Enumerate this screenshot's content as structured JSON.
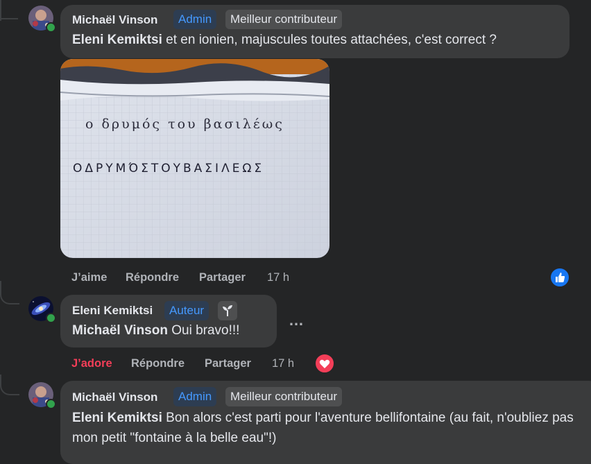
{
  "comments": [
    {
      "author": "Michaël Vinson",
      "badges": [
        "Admin",
        "Meilleur contributeur"
      ],
      "mention": "Eleni Kemiktsi",
      "text": " et en ionien, majuscules toutes attachées, c'est correct ?",
      "image": {
        "line1": "ο δρυμός του βασιλέως",
        "line2": "ΟΔΡΥΜΌΣΤΟΥΒΑΣΙΛΕΩΣ"
      },
      "actions": {
        "like": "J’aime",
        "reply": "Répondre",
        "share": "Partager",
        "time": "17 h"
      },
      "reaction": "like-icon"
    },
    {
      "author": "Eleni Kemiktsi",
      "badges": [
        "Auteur"
      ],
      "mention": "Michaël Vinson",
      "text": " Oui bravo!!!",
      "more": "…",
      "actions": {
        "like": "J’adore",
        "reply": "Répondre",
        "share": "Partager",
        "time": "17 h"
      },
      "reaction": "love-icon"
    },
    {
      "author": "Michaël Vinson",
      "badges": [
        "Admin",
        "Meilleur contributeur"
      ],
      "mention": "Eleni Kemiktsi",
      "text": " Bon alors c'est parti pour l'aventure bellifontaine (au fait, n'oubliez pas mon petit \"fontaine à la belle eau\"!)"
    }
  ],
  "colors": {
    "background": "#242526",
    "bubble": "#3a3b3c",
    "admin_badge_text": "#4599ff",
    "love_red": "#f33e58",
    "like_blue": "#1877f2",
    "online_green": "#31a24c"
  }
}
